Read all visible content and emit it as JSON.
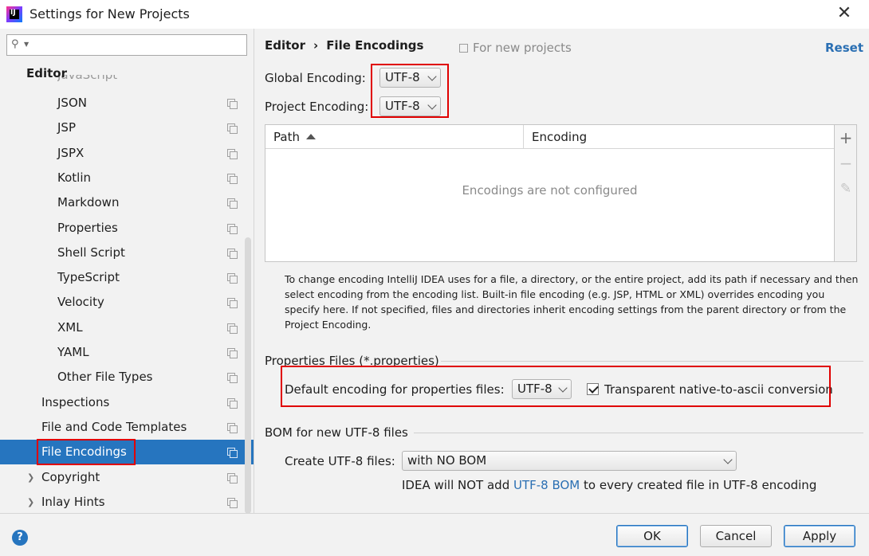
{
  "window": {
    "title": "Settings for New Projects"
  },
  "sidebar": {
    "search_placeholder": "",
    "section": "Editor",
    "cut_item": "JavaScript",
    "items": [
      {
        "label": "JSON",
        "level": 2
      },
      {
        "label": "JSP",
        "level": 2
      },
      {
        "label": "JSPX",
        "level": 2
      },
      {
        "label": "Kotlin",
        "level": 2
      },
      {
        "label": "Markdown",
        "level": 2
      },
      {
        "label": "Properties",
        "level": 2
      },
      {
        "label": "Shell Script",
        "level": 2
      },
      {
        "label": "TypeScript",
        "level": 2
      },
      {
        "label": "Velocity",
        "level": 2
      },
      {
        "label": "XML",
        "level": 2
      },
      {
        "label": "YAML",
        "level": 2
      },
      {
        "label": "Other File Types",
        "level": 2
      },
      {
        "label": "Inspections",
        "level": 1
      },
      {
        "label": "File and Code Templates",
        "level": 1
      },
      {
        "label": "File Encodings",
        "level": 1,
        "selected": true
      },
      {
        "label": "Copyright",
        "level": 1,
        "expandable": true
      },
      {
        "label": "Inlay Hints",
        "level": 1,
        "expandable": true
      }
    ]
  },
  "header": {
    "breadcrumb_parent": "Editor",
    "breadcrumb_sep": "›",
    "breadcrumb_current": "File Encodings",
    "for_new_projects": "For new projects",
    "reset": "Reset"
  },
  "encodings": {
    "global_label": "Global Encoding:",
    "global_value": "UTF-8",
    "project_label": "Project Encoding:",
    "project_value": "UTF-8"
  },
  "table": {
    "col_path": "Path",
    "col_encoding": "Encoding",
    "empty": "Encodings are not configured",
    "add": "+",
    "remove": "−",
    "edit": "✎"
  },
  "hint": "To change encoding IntelliJ IDEA uses for a file, a directory, or the entire project, add its path if necessary and then select encoding from the encoding list. Built-in file encoding (e.g. JSP, HTML or XML) overrides encoding you specify here. If not specified, files and directories inherit encoding settings from the parent directory or from the Project Encoding.",
  "properties": {
    "group_title": "Properties Files (*.properties)",
    "default_label": "Default encoding for properties files:",
    "default_value": "UTF-8",
    "native_ascii_label": "Transparent native-to-ascii conversion",
    "native_ascii_checked": true
  },
  "bom": {
    "group_title": "BOM for new UTF-8 files",
    "create_label": "Create UTF-8 files:",
    "create_value": "with NO BOM",
    "note_prefix": "IDEA will NOT add ",
    "note_link": "UTF-8 BOM",
    "note_suffix": " to every created file in UTF-8 encoding"
  },
  "footer": {
    "help": "?",
    "ok": "OK",
    "cancel": "Cancel",
    "apply": "Apply"
  },
  "colors": {
    "accent": "#2675bf",
    "link": "#2a6fb3",
    "highlight_box": "#e00000"
  }
}
